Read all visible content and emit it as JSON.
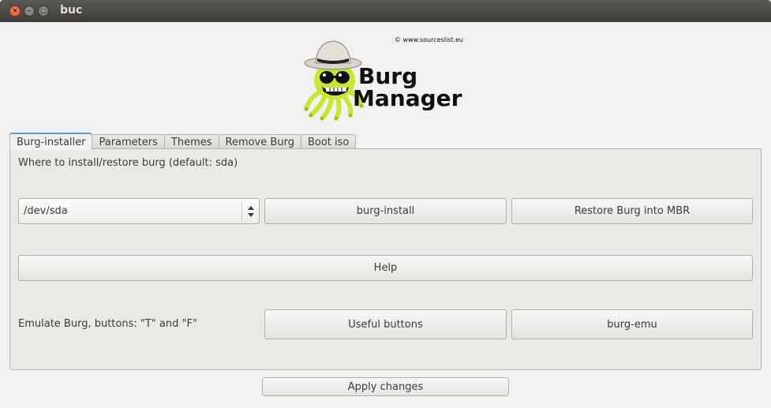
{
  "window": {
    "title": "buc",
    "close_glyph": "×",
    "minimize_glyph": "–",
    "maximize_glyph": "□"
  },
  "logo": {
    "copyright": "© www.sourceslist.eu",
    "line1": "Burg",
    "line2": "Manager",
    "mascot": "octopus-mascot-with-hat",
    "mascot_color": "#c8e632"
  },
  "tabs": [
    {
      "label": "Burg-installer",
      "active": true
    },
    {
      "label": "Parameters",
      "active": false
    },
    {
      "label": "Themes",
      "active": false
    },
    {
      "label": "Remove Burg",
      "active": false
    },
    {
      "label": "Boot iso",
      "active": false
    }
  ],
  "installer": {
    "install_prompt": "Where to install/restore burg (default: sda)",
    "device_value": "/dev/sda",
    "burg_install_label": "burg-install",
    "restore_label": "Restore Burg into MBR",
    "help_label": "Help",
    "emulate_label": "Emulate Burg, buttons: \"T\" and \"F\"",
    "useful_buttons_label": "Useful buttons",
    "burg_emu_label": "burg-emu"
  },
  "footer": {
    "apply_label": "Apply changes"
  },
  "colors": {
    "titlebar": "#3f3e3a",
    "close_button": "#e0562a",
    "active_tab_accent": "#5b9bd5",
    "window_bg": "#f2f1f0"
  }
}
